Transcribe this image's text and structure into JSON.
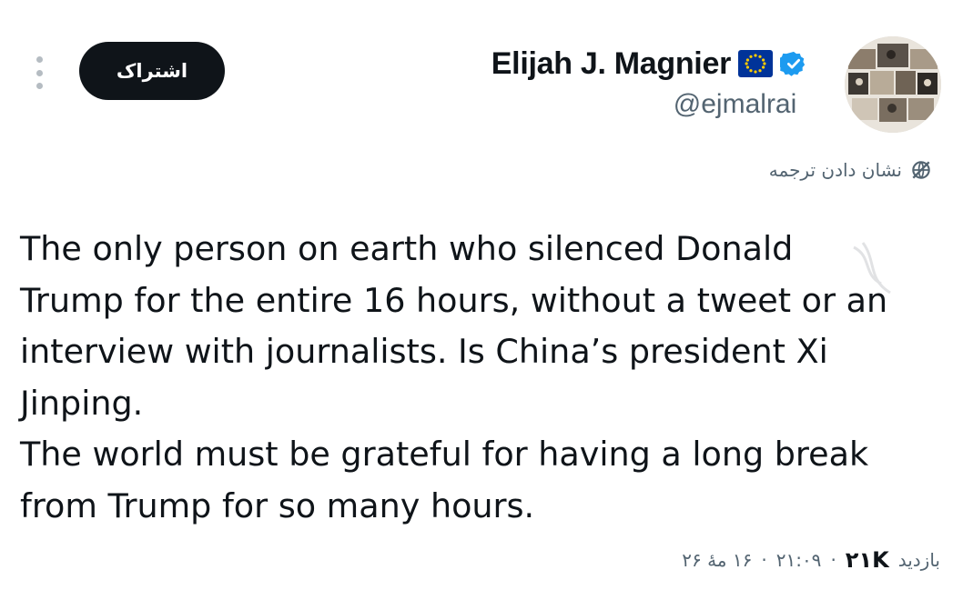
{
  "header": {
    "subscribe_label": "اشتراک",
    "more_icon": "more-vertical-icon"
  },
  "author": {
    "display_name": "Elijah J. Magnier",
    "flag_icon": "eu-flag-icon",
    "verified_icon": "verified-badge-icon",
    "verified_color": "#1d9bf0",
    "handle": "@ejmalrai",
    "avatar_icon": "profile-collage-avatar"
  },
  "translate": {
    "label": "نشان دادن ترجمه",
    "icon": "globe-icon"
  },
  "tweet": {
    "text": "The only person on earth who silenced Donald\nTrump for the entire 16 hours, without a tweet or an\ninterview with journalists. Is China’s president Xi\nJinping.\nThe world must be grateful for having a long break\nfrom Trump for so many hours."
  },
  "meta": {
    "views_label": "بازدید",
    "views_count": "۲۱K",
    "separator": "·",
    "time": "۲۱:۰۹",
    "date": "۱۶ مهٔ ۲۶"
  },
  "colors": {
    "text_primary": "#0f1419",
    "text_secondary": "#536471",
    "button_bg": "#0f1419",
    "button_text": "#ffffff",
    "eu_blue": "#003399",
    "eu_gold": "#ffcc00"
  }
}
